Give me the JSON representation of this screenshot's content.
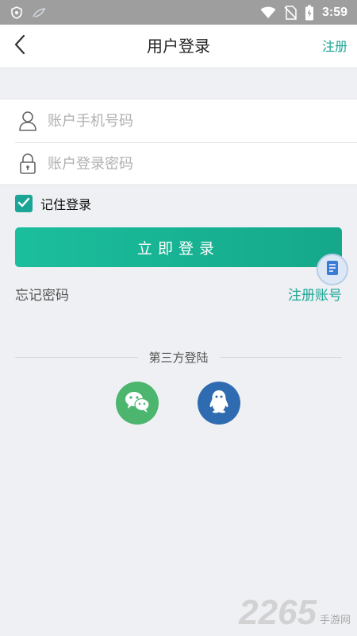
{
  "status_bar": {
    "time": "3:59",
    "icons": [
      "shield-icon",
      "leaf-icon",
      "wifi-icon",
      "no-sim-icon",
      "battery-charging-icon"
    ]
  },
  "header": {
    "title": "用户登录",
    "register_label": "注册",
    "back_icon": "chevron-left-icon"
  },
  "form": {
    "phone_placeholder": "账户手机号码",
    "password_placeholder": "账户登录密码",
    "phone_value": "",
    "password_value": "",
    "phone_icon": "user-icon",
    "password_icon": "lock-icon"
  },
  "remember": {
    "label": "记住登录",
    "checked": true
  },
  "login_button": {
    "label": "立即登录"
  },
  "links": {
    "forgot": "忘记密码",
    "register_account": "注册账号"
  },
  "third_party": {
    "label": "第三方登陆",
    "providers": [
      "wechat-icon",
      "qq-icon"
    ]
  },
  "watermark": {
    "number": "2265",
    "text": "手游网"
  },
  "colors": {
    "accent": "#1aa596",
    "button_start": "#1bbe9d",
    "button_end": "#15a88a",
    "wechat": "#4cb56e",
    "qq": "#2f6bb0",
    "background": "#eff0f3"
  }
}
